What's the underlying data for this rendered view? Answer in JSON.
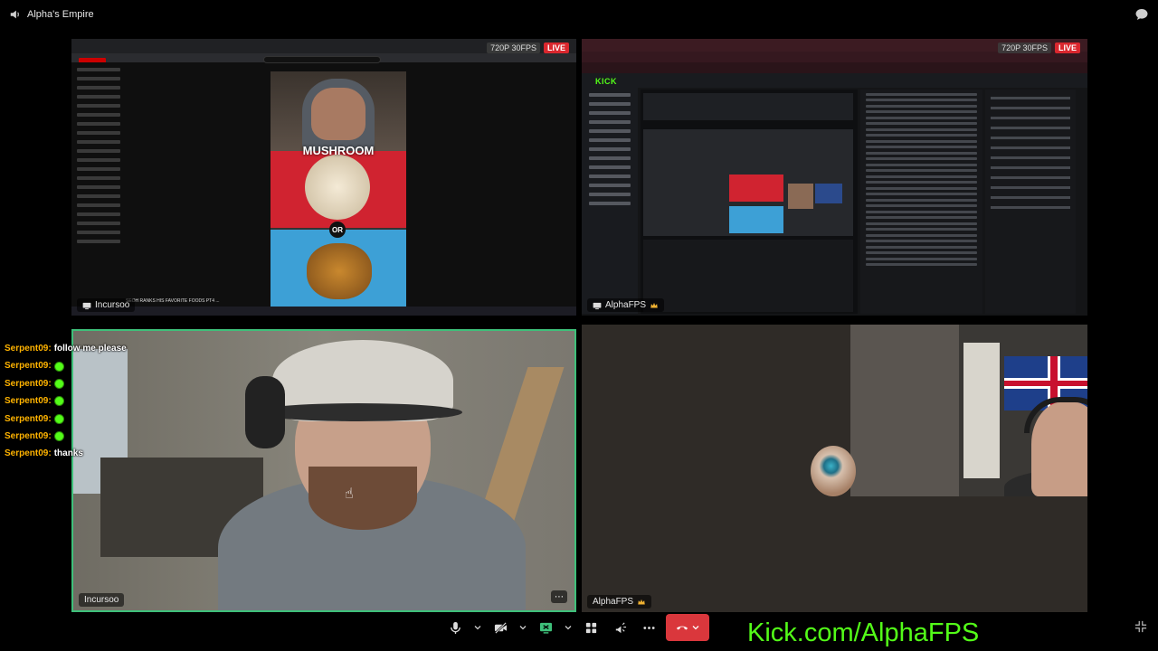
{
  "window": {
    "title": "Alpha's Empire",
    "speaker_icon": "speaker-icon",
    "chat_icon": "chat-bubble-icon"
  },
  "tiles": {
    "youtube_share": {
      "user": "Incursoo",
      "resolution": "720P 30FPS",
      "live": "LIVE",
      "content": {
        "overlay_text": "MUSHROOM",
        "or_label": "OR",
        "caption": "SEOH RANKS HIS FAVORITE FOODS PT4 ..."
      }
    },
    "kick_share": {
      "user": "AlphaFPS",
      "user_badge": "crown-icon",
      "resolution": "720P 30FPS",
      "live": "LIVE",
      "content": {
        "logo": "KICK"
      }
    },
    "incursoo_cam": {
      "user": "Incursoo",
      "more_icon": "more-dots-icon"
    },
    "alpha_cam": {
      "user": "AlphaFPS",
      "user_badge": "crown-icon"
    }
  },
  "chat_overlay": [
    {
      "user": "Serpent09:",
      "text": "follow me please",
      "emote": false
    },
    {
      "user": "Serpent09:",
      "text": "",
      "emote": true
    },
    {
      "user": "Serpent09:",
      "text": "",
      "emote": true
    },
    {
      "user": "Serpent09:",
      "text": "",
      "emote": true
    },
    {
      "user": "Serpent09:",
      "text": "",
      "emote": true
    },
    {
      "user": "Serpent09:",
      "text": "",
      "emote": true
    },
    {
      "user": "Serpent09:",
      "text": "thanks",
      "emote": false
    }
  ],
  "toolbar": {
    "mic_icon": "microphone-icon",
    "camera_icon": "camera-off-icon",
    "share_icon": "screen-share-icon",
    "activities_icon": "activities-icon",
    "soundboard_icon": "soundboard-icon",
    "more_icon": "more-dots-icon",
    "hangup_icon": "phone-hangup-icon"
  },
  "footer": {
    "kick_link": "Kick.com/AlphaFPS",
    "fullscreen_icon": "exit-fullscreen-icon"
  },
  "colors": {
    "kick_green": "#53fc18",
    "speaking_border": "#3ec07a",
    "live_red": "#d9272e",
    "hangup_red": "#da373c",
    "chat_username": "#ffb300"
  }
}
